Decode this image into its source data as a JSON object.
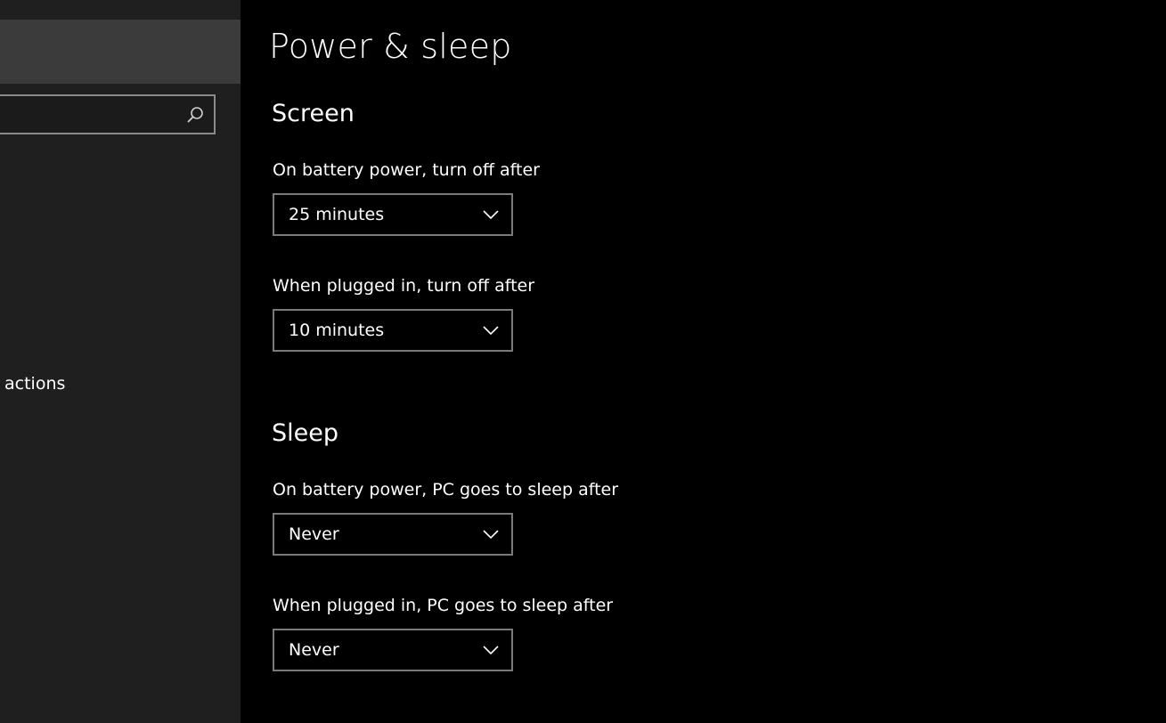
{
  "sidebar": {
    "search": {
      "value": "",
      "placeholder": "",
      "icon": "search-icon"
    },
    "items": [
      {
        "label": "actions"
      }
    ]
  },
  "main": {
    "title": "Power & sleep",
    "sections": [
      {
        "title": "Screen",
        "settings": [
          {
            "label": "On battery power, turn off after",
            "value": "25 minutes"
          },
          {
            "label": "When plugged in, turn off after",
            "value": "10 minutes"
          }
        ]
      },
      {
        "title": "Sleep",
        "settings": [
          {
            "label": "On battery power, PC goes to sleep after",
            "value": "Never"
          },
          {
            "label": "When plugged in, PC goes to sleep after",
            "value": "Never"
          }
        ]
      }
    ]
  },
  "colors": {
    "background": "#000000",
    "sidebar": "#1f1f1f",
    "sidebar_header": "#3b3b3b",
    "dropdown_border": "#7a7a7a",
    "text": "#ffffff"
  }
}
